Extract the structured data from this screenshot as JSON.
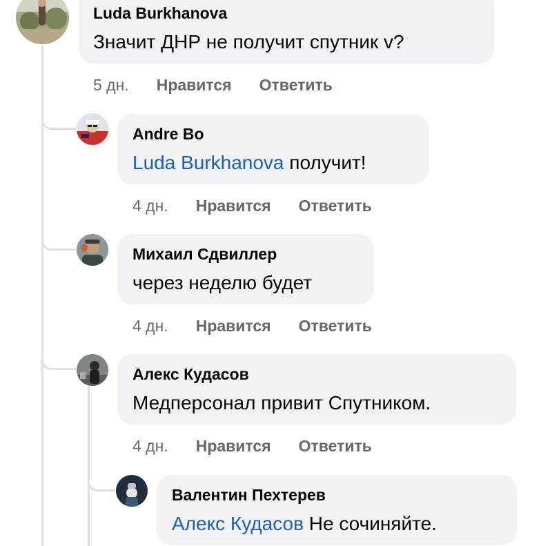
{
  "comments": [
    {
      "author": "Luda Burkhanova",
      "text": "Значит ДНР  не получит спутник v?",
      "time": "5 дн.",
      "like": "Нравится",
      "reply": "Ответить"
    },
    {
      "author": "Andre Bo",
      "mention": "Luda Burkhanova",
      "text": " получит!",
      "time": "4 дн.",
      "like": "Нравится",
      "reply": "Ответить"
    },
    {
      "author": "Михаил Сдвиллер",
      "text": "через неделю будет",
      "time": "4 дн.",
      "like": "Нравится",
      "reply": "Ответить"
    },
    {
      "author": "Алекс Кудасов",
      "text": "Медперсонал привит Спутником.",
      "time": "4 дн.",
      "like": "Нравится",
      "reply": "Ответить"
    },
    {
      "author": "Валентин Пехтерев",
      "mention": "Алекс Кудасов",
      "text": " Не сочиняйте.",
      "time": "",
      "like": "",
      "reply": ""
    }
  ]
}
